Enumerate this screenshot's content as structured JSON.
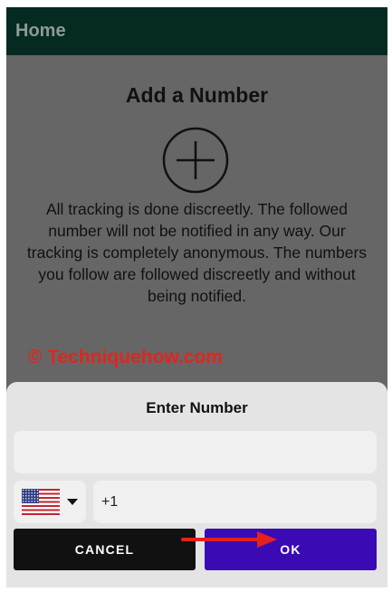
{
  "appbar": {
    "title": "Home"
  },
  "main": {
    "title": "Add a Number",
    "add_icon": "plus-circle-icon",
    "description": "All tracking is done discreetly. The followed number will not be notified in any way. Our tracking is completely anonymous. The numbers you follow are followed discreetly and without being notified."
  },
  "watermark": "© Techniquehow.com",
  "dialog": {
    "title": "Enter Number",
    "number_field": {
      "value": "",
      "placeholder": ""
    },
    "country": {
      "flag": "us-flag-icon",
      "dropdown_icon": "caret-down-icon"
    },
    "phone_field": {
      "value": "+1"
    },
    "cancel_label": "CANCEL",
    "ok_label": "OK"
  },
  "annotation": {
    "arrow_color": "#e8201a"
  },
  "colors": {
    "appbar_bg": "#042a22",
    "overlay_bg": "#666666",
    "sheet_bg": "#e4e4e4",
    "ok_button": "#3a0bb5",
    "cancel_button": "#111111",
    "watermark": "#e0261c"
  }
}
